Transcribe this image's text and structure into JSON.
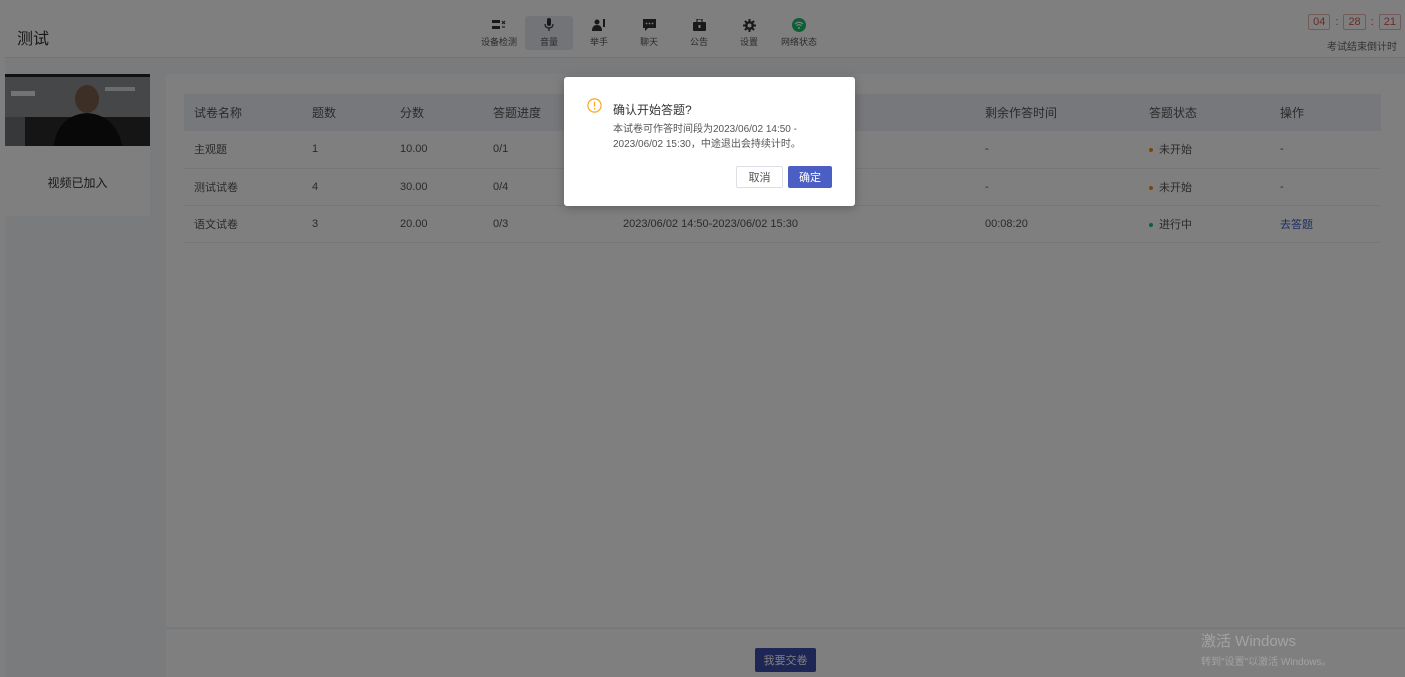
{
  "header": {
    "title": "测试",
    "toolbar": [
      {
        "label": "设备检测",
        "icon": "device-check-icon"
      },
      {
        "label": "音量",
        "icon": "microphone-icon",
        "active": true
      },
      {
        "label": "举手",
        "icon": "raise-hand-icon"
      },
      {
        "label": "聊天",
        "icon": "chat-icon"
      },
      {
        "label": "公告",
        "icon": "announcement-icon"
      },
      {
        "label": "设置",
        "icon": "gear-icon"
      },
      {
        "label": "网络状态",
        "icon": "wifi-icon"
      }
    ],
    "countdown": {
      "hours": "04",
      "minutes": "28",
      "seconds": "21",
      "caption": "考试结束倒计时"
    }
  },
  "video": {
    "status": "视频已加入"
  },
  "table": {
    "columns": [
      "试卷名称",
      "题数",
      "分数",
      "答题进度",
      "",
      "剩余作答时间",
      "答题状态",
      "操作"
    ],
    "rows": [
      {
        "name": "主观题",
        "count": "1",
        "score": "10.00",
        "progress": "0/1",
        "time": "",
        "remaining": "-",
        "status": "未开始",
        "status_color": "#ff8a00",
        "action": "-"
      },
      {
        "name": "测试试卷",
        "count": "4",
        "score": "30.00",
        "progress": "0/4",
        "time": "",
        "remaining": "-",
        "status": "未开始",
        "status_color": "#ff8a00",
        "action": "-"
      },
      {
        "name": "语文试卷",
        "count": "3",
        "score": "20.00",
        "progress": "0/3",
        "time": "2023/06/02 14:50-2023/06/02 15:30",
        "remaining": "00:08:20",
        "status": "进行中",
        "status_color": "#19be6b",
        "action": "去答题"
      }
    ]
  },
  "footer": {
    "submit_label": "我要交卷"
  },
  "dialog": {
    "title": "确认开始答题?",
    "body": "本试卷可作答时间段为2023/06/02 14:50 - 2023/06/02 15:30，中途退出会持续计时。",
    "cancel_label": "取消",
    "ok_label": "确定"
  },
  "watermark": {
    "line1": "激活 Windows",
    "line2": "转到\"设置\"以激活 Windows。"
  },
  "colors": {
    "accent": "#4b5ec4",
    "countdown": "#d9534f",
    "not_started": "#ff8a00",
    "in_progress": "#19be6b"
  }
}
